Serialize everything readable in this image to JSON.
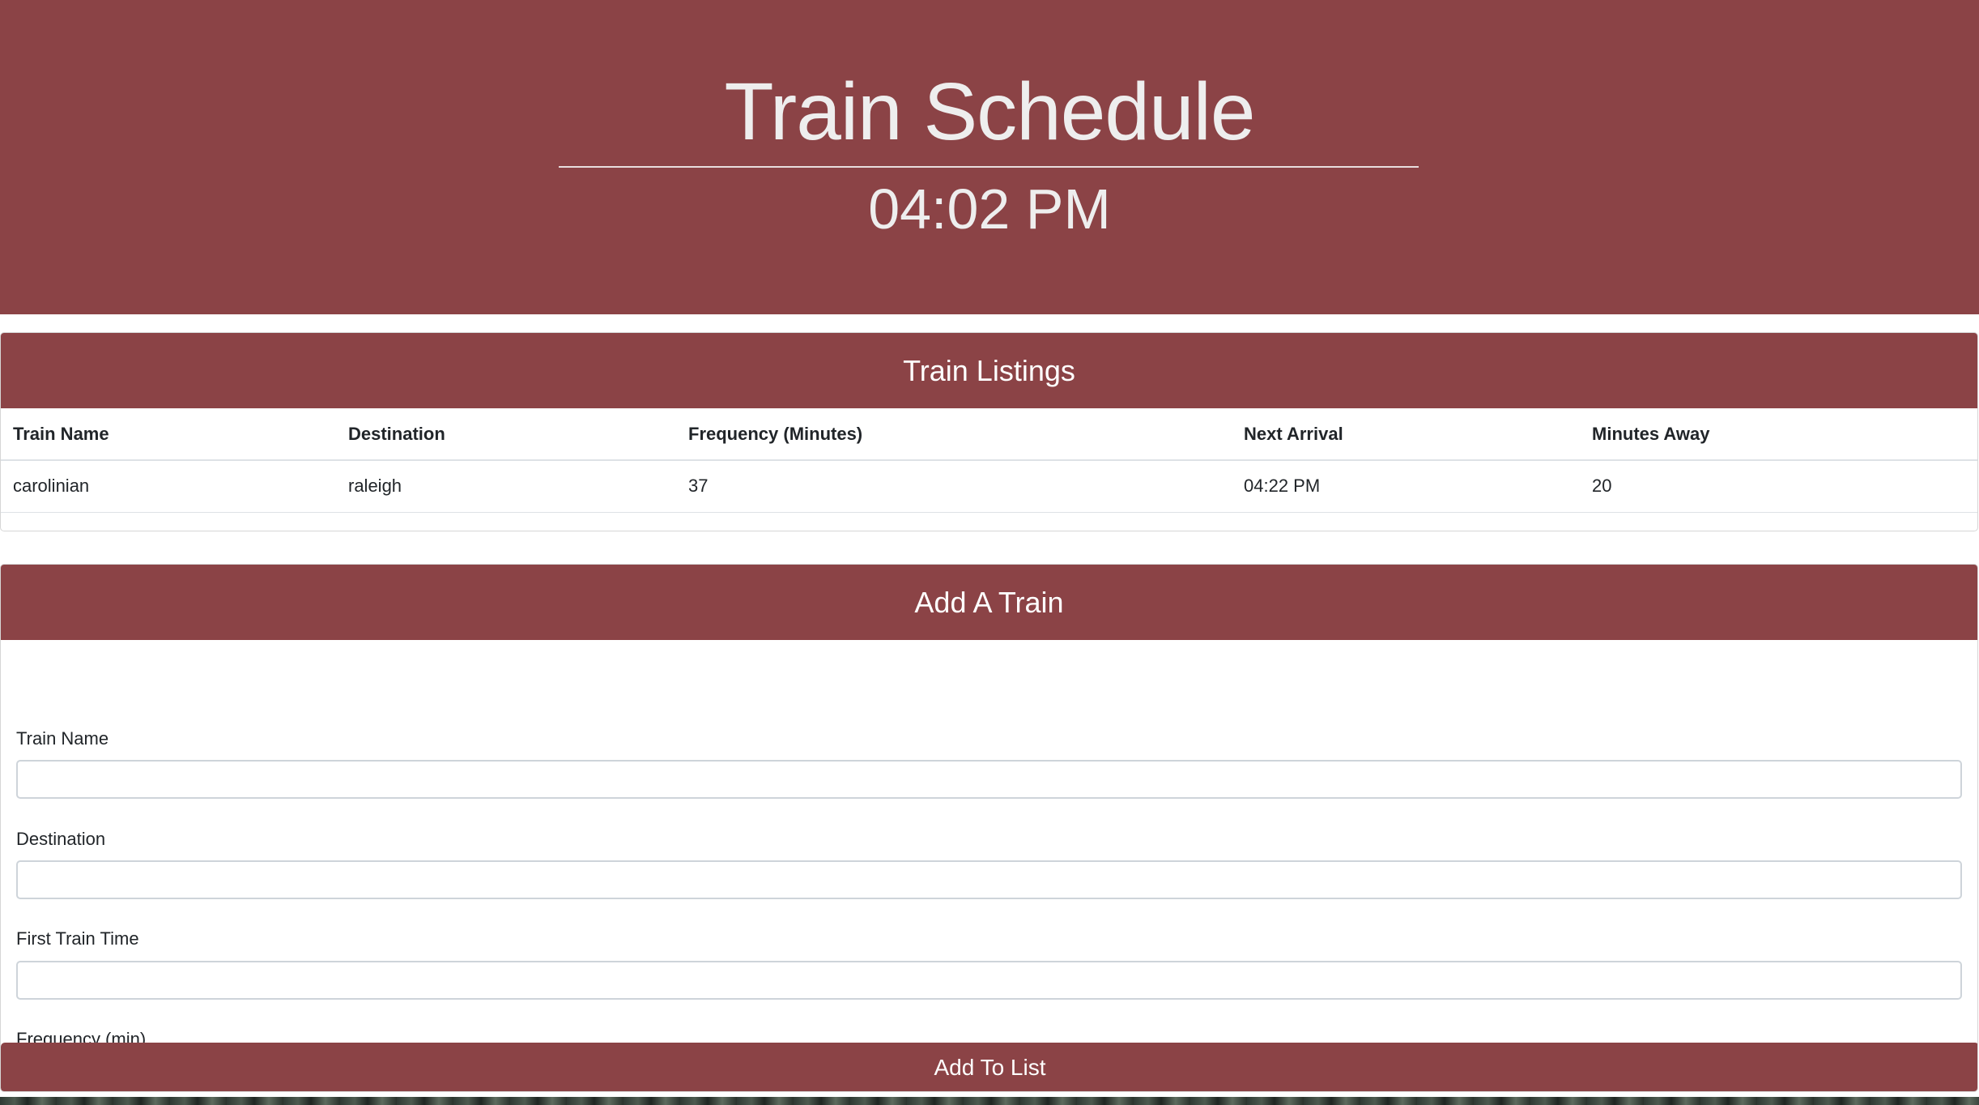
{
  "header": {
    "title": "Train Schedule",
    "current_time": "04:02 PM"
  },
  "listings": {
    "title": "Train Listings",
    "columns": [
      "Train Name",
      "Destination",
      "Frequency (Minutes)",
      "Next Arrival",
      "Minutes Away"
    ],
    "rows": [
      [
        "carolinian",
        "raleigh",
        "37",
        "04:22 PM",
        "20"
      ]
    ]
  },
  "form": {
    "title": "Add A Train",
    "fields": [
      {
        "label": "Train Name",
        "value": ""
      },
      {
        "label": "Destination",
        "value": ""
      },
      {
        "label": "First Train Time",
        "value": ""
      },
      {
        "label": "Frequency (min)",
        "value": ""
      }
    ],
    "submit_label": "Add To List"
  },
  "colors": {
    "accent": "#8b4346",
    "header_text": "#eeeeee",
    "border": "#dee2e6"
  }
}
